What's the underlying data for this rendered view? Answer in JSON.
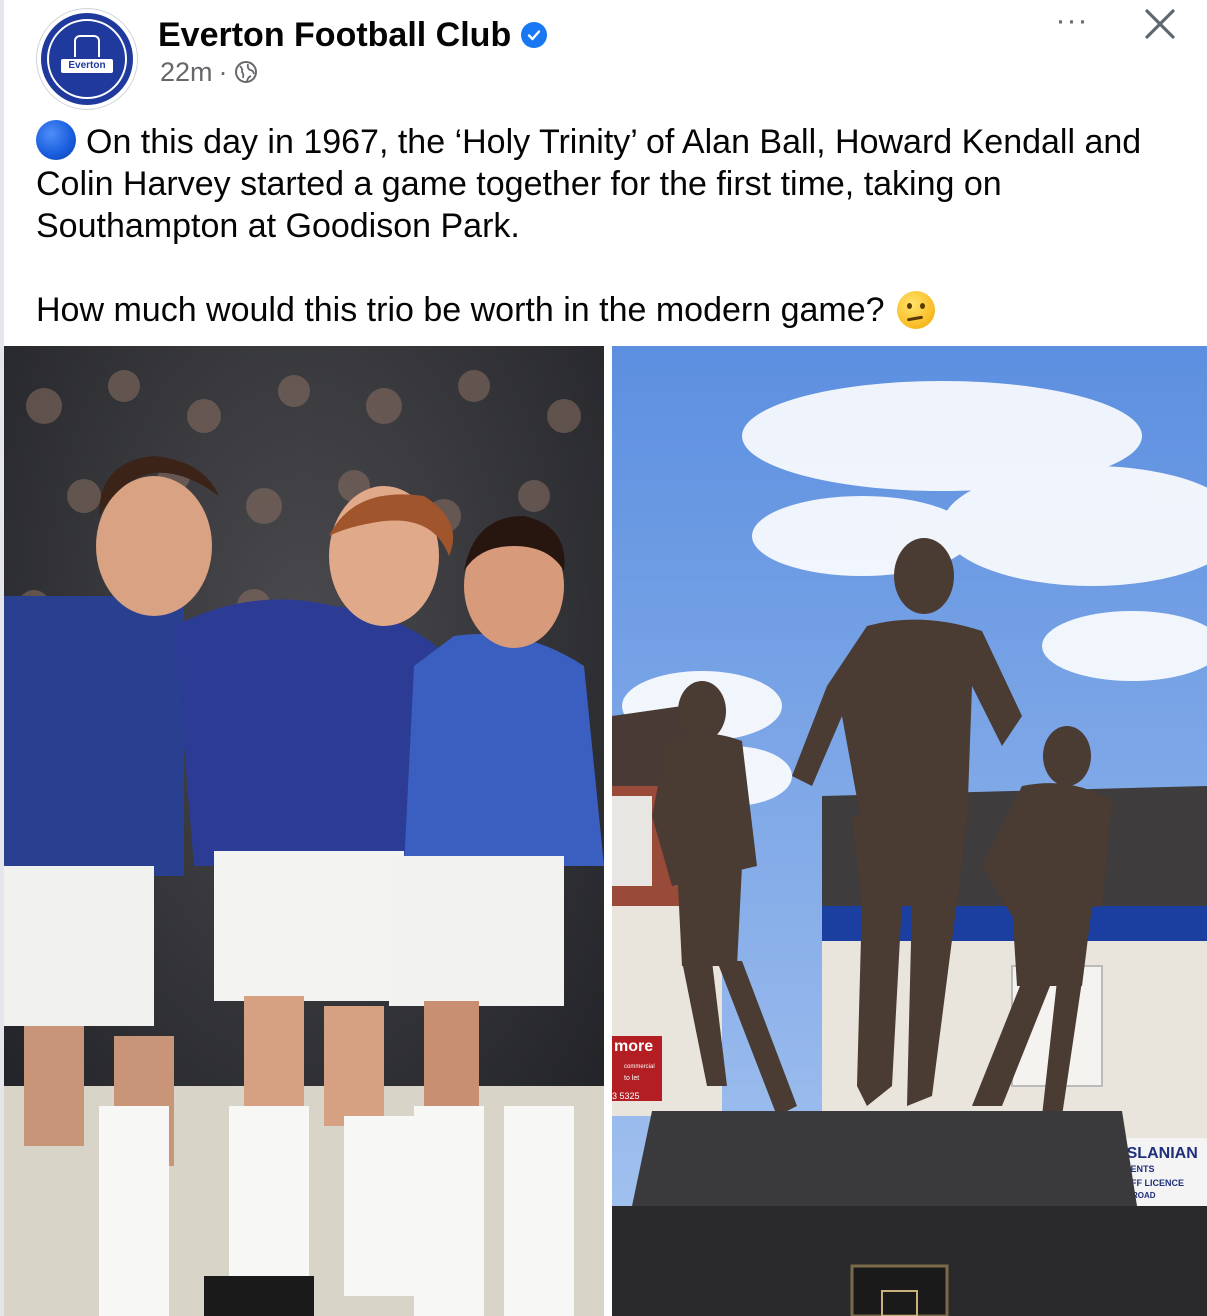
{
  "post": {
    "page_name": "Everton Football Club",
    "time": "22m",
    "separator": "·",
    "body_line1": "On this day in 1967, the ‘Holy Trinity’ of Alan Ball, Howard Kendall and Colin Harvey started a game together for the first time, taking on Southampton at Goodison Park.",
    "body_line2": "How much would this trio be worth in the modern game?",
    "more_label": "···",
    "avatar_text": "Everton"
  },
  "photo_right_signs": {
    "more": "more",
    "more_sub1": "commercial",
    "more_sub2": "to let",
    "phone": "3 5325",
    "shop_name": "S & H ARSLANIAN",
    "shop_line2": "NEWSAGENTS",
    "shop_line3": "OFF LICENCE",
    "shop_line4": "N ROAD"
  },
  "colors": {
    "accent": "#1877f2",
    "everton_blue": "#1f3a9c",
    "meta_gray": "#65676b"
  }
}
